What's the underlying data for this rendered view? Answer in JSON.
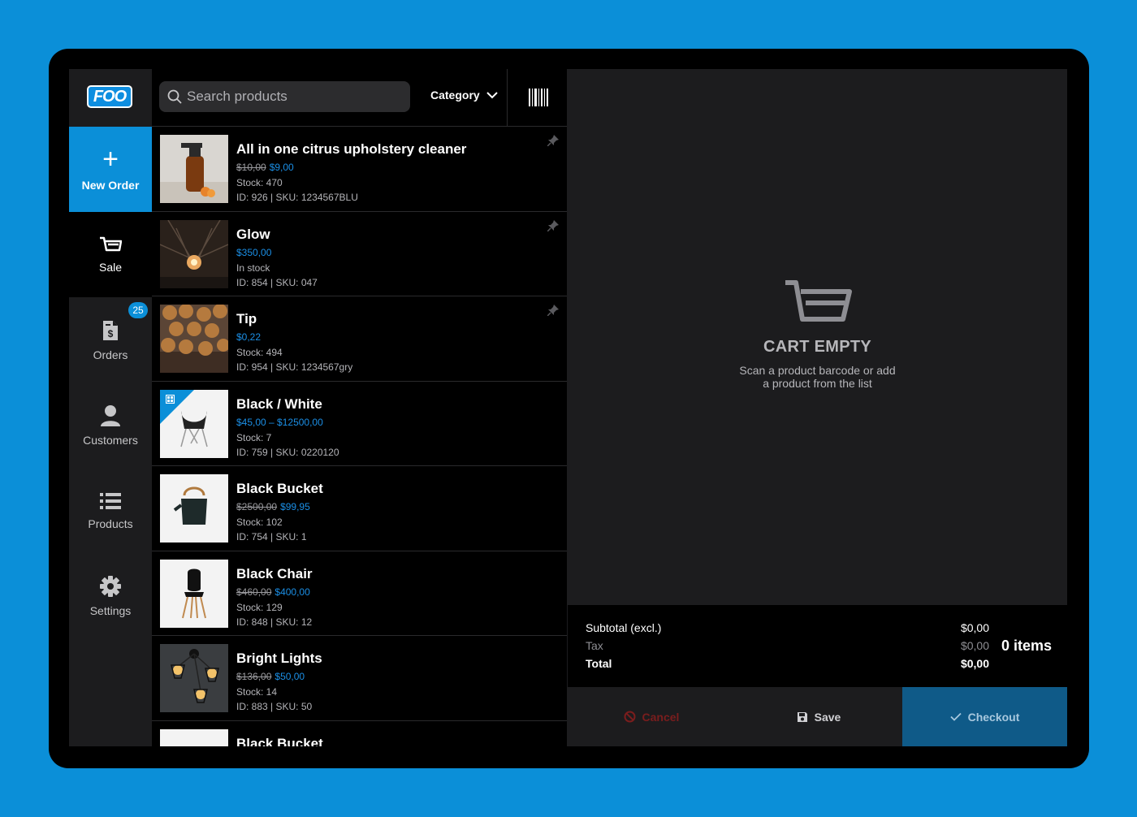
{
  "sidebar": {
    "logo_text": "FOO",
    "new_order_label": "New Order",
    "items": [
      {
        "label": "Sale",
        "icon": "cart-icon"
      },
      {
        "label": "Orders",
        "icon": "invoice-icon",
        "badge": "25"
      },
      {
        "label": "Customers",
        "icon": "user-icon"
      },
      {
        "label": "Products",
        "icon": "list-icon"
      },
      {
        "label": "Settings",
        "icon": "gear-icon"
      }
    ]
  },
  "toolbar": {
    "search_placeholder": "Search products",
    "category_label": "Category"
  },
  "products": [
    {
      "name": "All in one citrus upholstery cleaner",
      "old_price": "$10,00",
      "price": "$9,00",
      "stock": "Stock: 470",
      "ids": "ID: 926 | SKU: 1234567BLU"
    },
    {
      "name": "Glow",
      "old_price": "",
      "price": "$350,00",
      "stock": "In stock",
      "ids": "ID: 854 | SKU: 047"
    },
    {
      "name": "Tip",
      "old_price": "",
      "price": "$0,22",
      "stock": "Stock: 494",
      "ids": "ID: 954 | SKU: 1234567gry"
    },
    {
      "name": "Black / White",
      "old_price": "",
      "price": "$45,00 – $12500,00",
      "stock": "Stock: 7",
      "ids": "ID: 759 | SKU: 0220120"
    },
    {
      "name": "Black Bucket",
      "old_price": "$2500,00",
      "price": "$99,95",
      "stock": "Stock: 102",
      "ids": "ID: 754 | SKU: 1"
    },
    {
      "name": "Black Chair",
      "old_price": "$460,00",
      "price": "$400,00",
      "stock": "Stock: 129",
      "ids": "ID: 848 | SKU: 12"
    },
    {
      "name": "Bright Lights",
      "old_price": "$136,00",
      "price": "$50,00",
      "stock": "Stock: 14",
      "ids": "ID: 883 | SKU: 50"
    },
    {
      "name": "Black Bucket",
      "old_price": "",
      "price": "",
      "stock": "",
      "ids": ""
    }
  ],
  "cart": {
    "empty_title": "CART EMPTY",
    "empty_line1": "Scan a product barcode or add",
    "empty_line2": "a product from the list",
    "subtotal_label": "Subtotal (excl.)",
    "subtotal_value": "$0,00",
    "tax_label": "Tax",
    "tax_value": "$0,00",
    "total_label": "Total",
    "total_value": "$0,00",
    "items_count": "0 items",
    "cancel_label": "Cancel",
    "save_label": "Save",
    "checkout_label": "Checkout"
  },
  "colors": {
    "accent": "#0b8fd8",
    "price_blue": "#1b8fe6",
    "cancel_red": "#7a1d1d",
    "checkout_bg": "#0f5a88"
  }
}
